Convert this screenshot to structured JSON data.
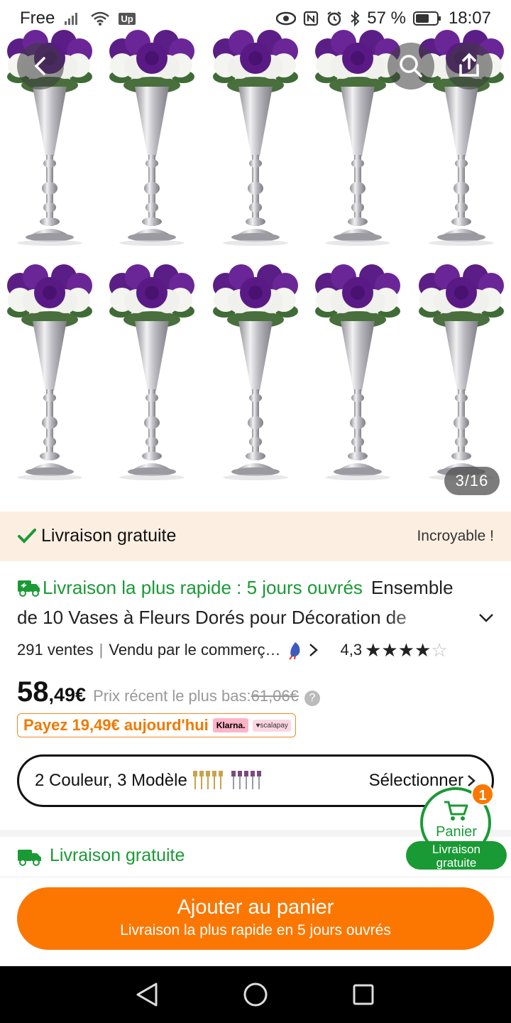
{
  "status_bar": {
    "carrier": "Free",
    "badge": "Up",
    "battery_percent": "57 %",
    "time": "18:07"
  },
  "gallery": {
    "counter": "3/16",
    "flower_colors": [
      "#5b1e86",
      "#f4f4f0"
    ],
    "vase_color": "#c8c8cc"
  },
  "banner": {
    "label": "Livraison gratuite",
    "tagline": "Incroyable !"
  },
  "product": {
    "fast_delivery": "Livraison la plus rapide : 5 jours ouvrés",
    "title_part1": "Ensemble",
    "title_part2": "de 10 Vases à Fleurs Dorés pour Décoration de",
    "sales": "291 ventes",
    "seller": "Vendu par le commerç…",
    "rating": "4,3",
    "rating_value": 4.3,
    "price_main": "58",
    "price_cents": ",49€",
    "recent_low_label": "Prix récent le plus bas:",
    "recent_low_value": "61,06€",
    "klarna_offer": "Payez 19,49€ aujourd'hui",
    "klarna_logo": "Klarna.",
    "scalapay_logo": "♥scalapay"
  },
  "options": {
    "summary": "2 Couleur, 3 Modèle",
    "select_label": "Sélectionner"
  },
  "shipping": {
    "label": "Livraison gratuite"
  },
  "cart_float": {
    "badge": "1",
    "label": "Panier",
    "sub1": "Livraison",
    "sub2": "gratuite"
  },
  "cta": {
    "label": "Ajouter au panier",
    "sub": "Livraison la plus rapide en 5 jours ouvrés"
  }
}
